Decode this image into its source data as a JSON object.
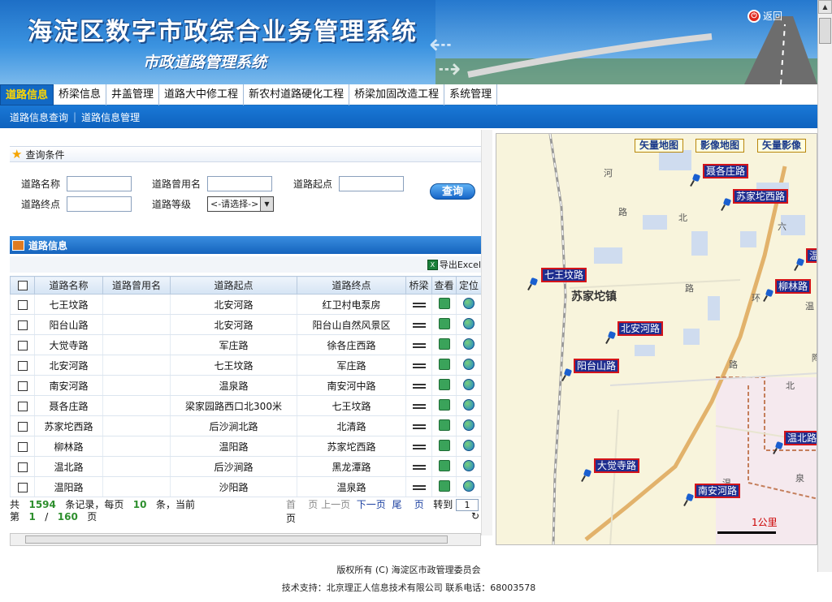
{
  "header": {
    "title": "海淀区数字市政综合业务管理系统",
    "subtitle": "市政道路管理系统",
    "return_label": "返回"
  },
  "tabs": [
    {
      "label": "道路信息",
      "active": true
    },
    {
      "label": "桥梁信息"
    },
    {
      "label": "井盖管理"
    },
    {
      "label": "道路大中修工程"
    },
    {
      "label": "新农村道路硬化工程"
    },
    {
      "label": "桥梁加固改造工程"
    },
    {
      "label": "系统管理"
    }
  ],
  "subnav": [
    "道路信息查询",
    "道路信息管理"
  ],
  "query": {
    "title": "查询条件",
    "fields": {
      "road_name": "道路名称",
      "former_name": "道路曾用名",
      "start": "道路起点",
      "end": "道路终点",
      "grade": "道路等级"
    },
    "grade_selected": "<-请选择->",
    "search_label": "查询"
  },
  "roads": {
    "title": "道路信息",
    "export_label": "导出Excel",
    "columns": [
      "道路名称",
      "道路曾用名",
      "道路起点",
      "道路终点",
      "桥梁",
      "查看",
      "定位"
    ],
    "rows": [
      [
        "七王坟路",
        "",
        "北安河路",
        "红卫村电泵房"
      ],
      [
        "阳台山路",
        "",
        "北安河路",
        "阳台山自然风景区"
      ],
      [
        "大觉寺路",
        "",
        "军庄路",
        "徐各庄西路"
      ],
      [
        "北安河路",
        "",
        "七王坟路",
        "军庄路"
      ],
      [
        "南安河路",
        "",
        "温泉路",
        "南安河中路"
      ],
      [
        "聂各庄路",
        "",
        "梁家园路西口北300米",
        "七王坟路"
      ],
      [
        "苏家坨西路",
        "",
        "后沙涧北路",
        "北清路"
      ],
      [
        "柳林路",
        "",
        "温阳路",
        "苏家坨西路"
      ],
      [
        "温北路",
        "",
        "后沙涧路",
        "黑龙潭路"
      ],
      [
        "温阳路",
        "",
        "沙阳路",
        "温泉路"
      ]
    ]
  },
  "pager": {
    "total_prefix": "共",
    "total": "1594",
    "per_page_prefix": "条记录，每页",
    "per_page": "10",
    "current_prefix": "条，当前",
    "page_prefix": "第",
    "page": "1",
    "sep": "/",
    "pages": "160",
    "page_suffix": "页",
    "first": "首",
    "prev_label": "页",
    "prev": "上一页",
    "next": "下一页",
    "last": "尾",
    "last_suffix": "页",
    "goto": "转到",
    "goto_value": "1",
    "goto_suffix": "页"
  },
  "map": {
    "buttons": [
      "矢量地图",
      "影像地图",
      "矢量影像"
    ],
    "town": "苏家坨镇",
    "road_labels": [
      "聂各庄路",
      "苏家坨西路",
      "七王坟路",
      "柳林路",
      "北安河路",
      "阳台山路",
      "温北路",
      "大觉寺路",
      "南安河路",
      "温"
    ],
    "map_chars": [
      "河",
      "路",
      "北",
      "路",
      "六",
      "环",
      "温",
      "路",
      "北",
      "温",
      "泉",
      "陶"
    ],
    "scale": "1公里"
  },
  "footer": {
    "copyright": "版权所有 (C)  海淀区市政管理委员会",
    "support": "技术支持：北京理正人信息技术有限公司   联系电话：68003578"
  }
}
